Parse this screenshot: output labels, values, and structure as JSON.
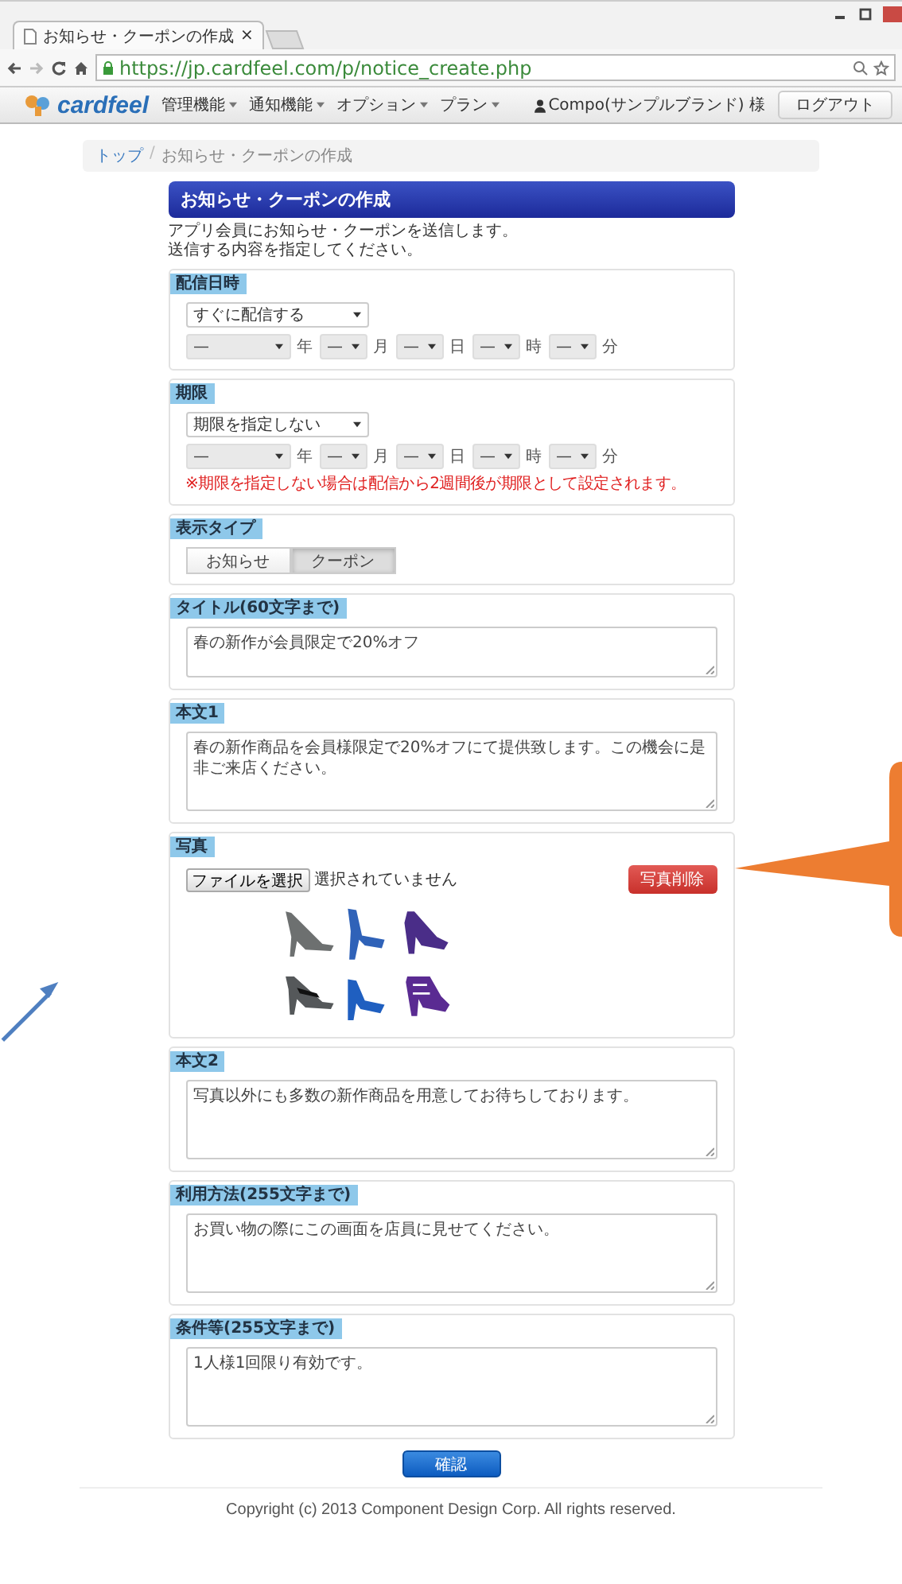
{
  "browser": {
    "tab_title": "お知らせ・クーポンの作成",
    "tab_close": "×",
    "url": "https://jp.cardfeel.com/p/notice_create.php"
  },
  "site_nav": {
    "logo": "cardfeel",
    "menus": [
      {
        "label": "管理機能"
      },
      {
        "label": "通知機能"
      },
      {
        "label": "オプション"
      },
      {
        "label": "プラン"
      }
    ],
    "user": "Compo(サンプルブランド) 様",
    "logout": "ログアウト"
  },
  "breadcrumb": {
    "items": [
      {
        "label": "トップ",
        "link": true
      },
      {
        "label": "お知らせ・クーポンの作成",
        "link": false
      }
    ],
    "separator": "/"
  },
  "form": {
    "title": "お知らせ・クーポンの作成",
    "intro": [
      "アプリ会員にお知らせ・クーポンを送信します。",
      "送信する内容を指定してください。"
    ],
    "sections": [
      {
        "kind": "schedule",
        "label": "配信日時",
        "select": "すぐに配信する",
        "parts": [
          {
            "value": "—",
            "unit": "年"
          },
          {
            "value": "—",
            "unit": "月"
          },
          {
            "value": "—",
            "unit": "日"
          },
          {
            "value": "—",
            "unit": "時"
          },
          {
            "value": "—",
            "unit": "分"
          }
        ]
      },
      {
        "kind": "schedule",
        "label": "期限",
        "select": "期限を指定しない",
        "parts": [
          {
            "value": "—",
            "unit": "年"
          },
          {
            "value": "—",
            "unit": "月"
          },
          {
            "value": "—",
            "unit": "日"
          },
          {
            "value": "—",
            "unit": "時"
          },
          {
            "value": "—",
            "unit": "分"
          }
        ],
        "note": "※期限を指定しない場合は配信から2週間後が期限として設定されます。"
      },
      {
        "kind": "type",
        "label": "表示タイプ",
        "options": [
          {
            "label": "お知らせ",
            "selected": false
          },
          {
            "label": "クーポン",
            "selected": true
          }
        ]
      },
      {
        "kind": "text",
        "label": "タイトル(60文字まで)",
        "value": "春の新作が会員限定で20%オフ"
      },
      {
        "kind": "text",
        "label": "本文1",
        "value": "春の新作商品を会員様限定で20%オフにて提供致します。この機会に是非ご来店ください。"
      },
      {
        "label": "写真",
        "file_button": "ファイルを選択",
        "file_status": "選択されていません",
        "delete_button": "写真削除"
      },
      {
        "kind": "text",
        "label": "本文2",
        "value": "写真以外にも多数の新作商品を用意してお待ちしております。"
      },
      {
        "kind": "text",
        "label": "利用方法(255文字まで)",
        "value": "お買い物の際にこの画面を店員に見せてください。"
      },
      {
        "kind": "text",
        "label": "条件等(255文字まで)",
        "value": "1人様1回限り有効です。"
      }
    ],
    "submit": "確認"
  },
  "footer": {
    "copyright": "Copyright (c) 2013 Component Design Corp. All rights reserved."
  }
}
